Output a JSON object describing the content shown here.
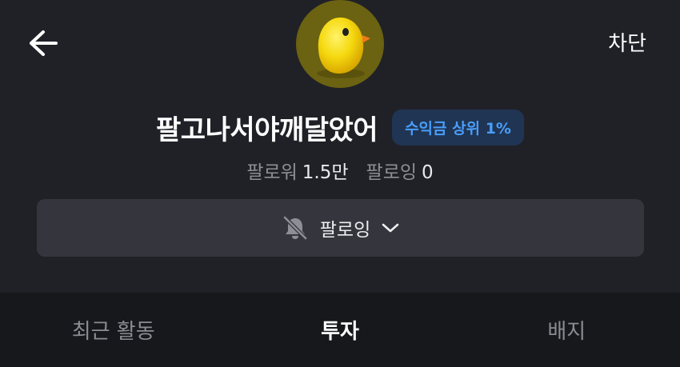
{
  "header": {
    "back_icon": "arrow-left-icon",
    "block_label": "차단"
  },
  "profile": {
    "avatar_icon": "yellow-chick-icon",
    "nickname": "팔고나서야깨달았어",
    "badge": "수익금 상위 1%",
    "followers_label": "팔로워",
    "followers_value": "1.5만",
    "following_label": "팔로잉",
    "following_value": "0"
  },
  "follow_button": {
    "bell_icon": "bell-off-icon",
    "label": "팔로잉",
    "chevron_icon": "chevron-down-icon"
  },
  "tabs": [
    {
      "label": "최근 활동",
      "active": false
    },
    {
      "label": "투자",
      "active": true
    },
    {
      "label": "배지",
      "active": false
    }
  ],
  "colors": {
    "background": "#202127",
    "tabbar_background": "#17181c",
    "button_background": "#34353d",
    "badge_background": "#1f3553",
    "badge_text": "#4a9dfa",
    "muted_text": "#8e8f96"
  }
}
